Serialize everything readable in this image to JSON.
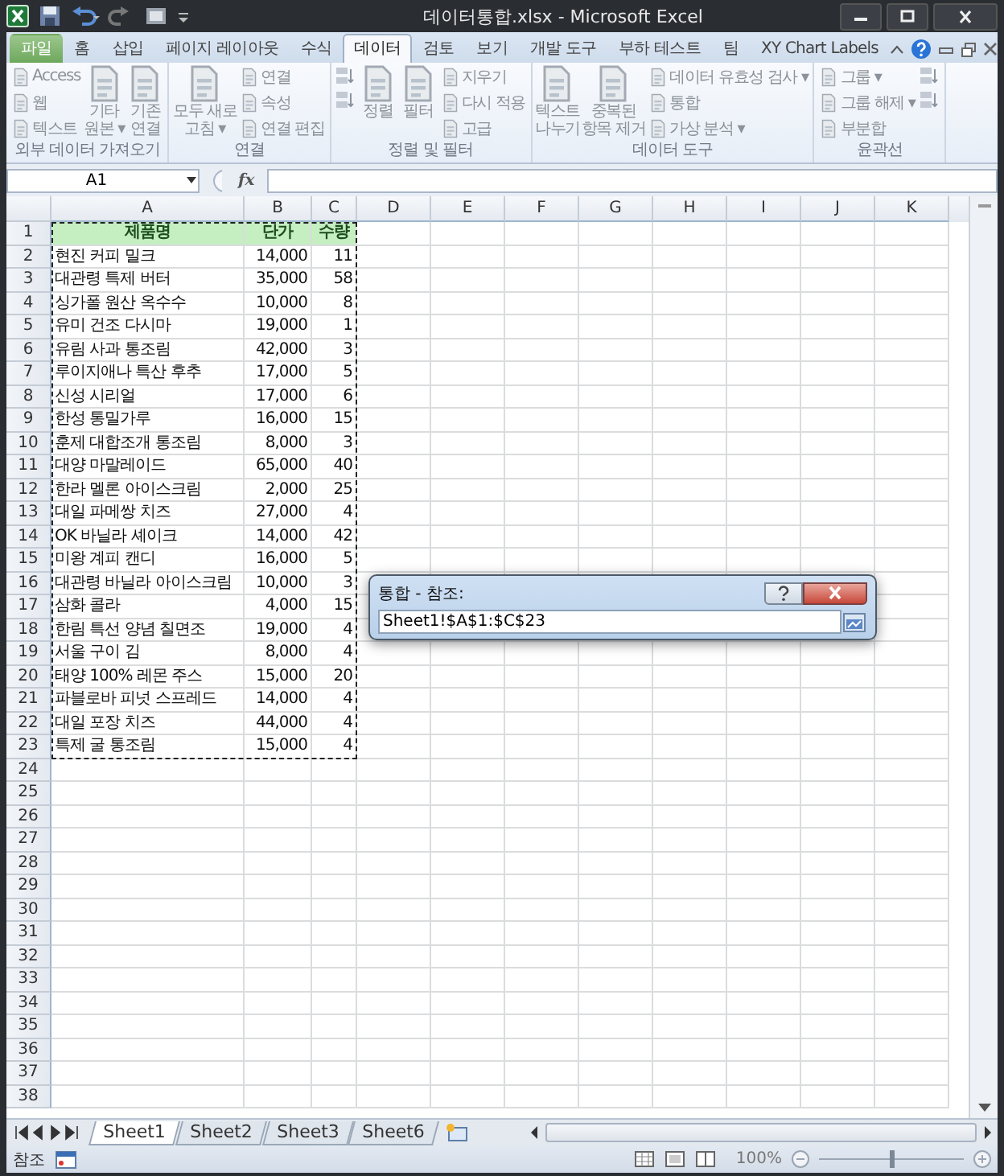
{
  "window": {
    "title": "데이터통합.xlsx - Microsoft Excel"
  },
  "ribbon_tabs": [
    {
      "label": "파일",
      "kind": "file",
      "selected": false
    },
    {
      "label": "홈",
      "kind": "tab",
      "selected": false
    },
    {
      "label": "삽입",
      "kind": "tab",
      "selected": false
    },
    {
      "label": "페이지 레이아웃",
      "kind": "tab",
      "selected": false
    },
    {
      "label": "수식",
      "kind": "tab",
      "selected": false
    },
    {
      "label": "데이터",
      "kind": "tab",
      "selected": true
    },
    {
      "label": "검토",
      "kind": "tab",
      "selected": false
    },
    {
      "label": "보기",
      "kind": "tab",
      "selected": false
    },
    {
      "label": "개발 도구",
      "kind": "tab",
      "selected": false
    },
    {
      "label": "부하 테스트",
      "kind": "tab",
      "selected": false
    },
    {
      "label": "팀",
      "kind": "tab",
      "selected": false
    },
    {
      "label": "XY Chart Labels",
      "kind": "tab",
      "selected": false
    }
  ],
  "ribbon_groups": [
    {
      "label": "외부 데이터 가져오기",
      "items": [
        {
          "kind": "small",
          "lines": [
            "Access"
          ]
        },
        {
          "kind": "small",
          "lines": [
            "웹"
          ]
        },
        {
          "kind": "small",
          "lines": [
            "텍스트"
          ]
        },
        {
          "kind": "large",
          "lines": [
            "기타",
            "원본 ▾"
          ]
        },
        {
          "kind": "large",
          "lines": [
            "기존",
            "연결"
          ]
        }
      ]
    },
    {
      "label": "연결",
      "items": [
        {
          "kind": "large",
          "lines": [
            "모두 새로",
            "고침 ▾"
          ]
        },
        {
          "kind": "small",
          "lines": [
            "연결"
          ]
        },
        {
          "kind": "small",
          "lines": [
            "속성"
          ]
        },
        {
          "kind": "small",
          "lines": [
            "연결 편집"
          ]
        }
      ]
    },
    {
      "label": "정렬 및 필터",
      "items": [
        {
          "kind": "icons"
        },
        {
          "kind": "large",
          "lines": [
            "정렬"
          ]
        },
        {
          "kind": "large",
          "lines": [
            "필터"
          ]
        },
        {
          "kind": "small",
          "lines": [
            "지우기"
          ]
        },
        {
          "kind": "small",
          "lines": [
            "다시 적용"
          ]
        },
        {
          "kind": "small",
          "lines": [
            "고급"
          ]
        }
      ]
    },
    {
      "label": "데이터 도구",
      "items": [
        {
          "kind": "large",
          "lines": [
            "텍스트",
            "나누기"
          ]
        },
        {
          "kind": "large",
          "lines": [
            "중복된",
            "항목 제거"
          ]
        },
        {
          "kind": "small",
          "lines": [
            "데이터 유효성 검사 ▾"
          ]
        },
        {
          "kind": "small",
          "lines": [
            "통합"
          ]
        },
        {
          "kind": "small",
          "lines": [
            "가상 분석 ▾"
          ]
        }
      ]
    },
    {
      "label": "윤곽선",
      "items": [
        {
          "kind": "small",
          "lines": [
            "그룹 ▾"
          ]
        },
        {
          "kind": "small",
          "lines": [
            "그룹 해제 ▾"
          ]
        },
        {
          "kind": "small",
          "lines": [
            "부분합"
          ]
        },
        {
          "kind": "icons"
        }
      ]
    }
  ],
  "formula_bar": {
    "name_box": "A1",
    "function_label": "fx"
  },
  "columns": [
    "A",
    "B",
    "C",
    "D",
    "E",
    "F",
    "G",
    "H",
    "I",
    "J",
    "K"
  ],
  "rows": [
    {
      "number": "1",
      "kind": "header",
      "cells": [
        "제품명",
        "단가",
        "수량"
      ]
    },
    {
      "number": "2",
      "kind": "data",
      "cells": [
        "현진 커피 밀크",
        "14,000",
        "11"
      ]
    },
    {
      "number": "3",
      "kind": "data",
      "cells": [
        "대관령 특제 버터",
        "35,000",
        "58"
      ]
    },
    {
      "number": "4",
      "kind": "data",
      "cells": [
        "싱가폴 원산 옥수수",
        "10,000",
        "8"
      ]
    },
    {
      "number": "5",
      "kind": "data",
      "cells": [
        "유미 건조 다시마",
        "19,000",
        "1"
      ]
    },
    {
      "number": "6",
      "kind": "data",
      "cells": [
        "유림 사과 통조림",
        "42,000",
        "3"
      ]
    },
    {
      "number": "7",
      "kind": "data",
      "cells": [
        "루이지애나 특산 후추",
        "17,000",
        "5"
      ]
    },
    {
      "number": "8",
      "kind": "data",
      "cells": [
        "신성 시리얼",
        "17,000",
        "6"
      ]
    },
    {
      "number": "9",
      "kind": "data",
      "cells": [
        "한성 통밀가루",
        "16,000",
        "15"
      ]
    },
    {
      "number": "10",
      "kind": "data",
      "cells": [
        "훈제 대합조개 통조림",
        "8,000",
        "3"
      ]
    },
    {
      "number": "11",
      "kind": "data",
      "cells": [
        "대양 마말레이드",
        "65,000",
        "40"
      ]
    },
    {
      "number": "12",
      "kind": "data",
      "cells": [
        "한라 멜론 아이스크림",
        "2,000",
        "25"
      ]
    },
    {
      "number": "13",
      "kind": "data",
      "cells": [
        "대일 파메쌍 치즈",
        "27,000",
        "4"
      ]
    },
    {
      "number": "14",
      "kind": "data",
      "cells": [
        "OK 바닐라 셰이크",
        "14,000",
        "42"
      ]
    },
    {
      "number": "15",
      "kind": "data",
      "cells": [
        "미왕 계피 캔디",
        "16,000",
        "5"
      ]
    },
    {
      "number": "16",
      "kind": "data",
      "cells": [
        "대관령 바닐라 아이스크림",
        "10,000",
        "3"
      ]
    },
    {
      "number": "17",
      "kind": "data",
      "cells": [
        "삼화 콜라",
        "4,000",
        "15"
      ]
    },
    {
      "number": "18",
      "kind": "data",
      "cells": [
        "한림 특선 양념 칠면조",
        "19,000",
        "4"
      ]
    },
    {
      "number": "19",
      "kind": "data",
      "cells": [
        "서울 구이 김",
        "8,000",
        "4"
      ]
    },
    {
      "number": "20",
      "kind": "data",
      "cells": [
        "태양 100% 레몬 주스",
        "15,000",
        "20"
      ]
    },
    {
      "number": "21",
      "kind": "data",
      "cells": [
        "파블로바 피넛 스프레드",
        "14,000",
        "4"
      ]
    },
    {
      "number": "22",
      "kind": "data",
      "cells": [
        "대일 포장 치즈",
        "44,000",
        "4"
      ]
    },
    {
      "number": "23",
      "kind": "data",
      "cells": [
        "특제 굴 통조림",
        "15,000",
        "4"
      ]
    },
    {
      "number": "24",
      "kind": "empty"
    },
    {
      "number": "25",
      "kind": "empty"
    },
    {
      "number": "26",
      "kind": "empty"
    },
    {
      "number": "27",
      "kind": "empty"
    },
    {
      "number": "28",
      "kind": "empty"
    },
    {
      "number": "29",
      "kind": "empty"
    },
    {
      "number": "30",
      "kind": "empty"
    },
    {
      "number": "31",
      "kind": "empty"
    },
    {
      "number": "32",
      "kind": "empty"
    },
    {
      "number": "33",
      "kind": "empty"
    },
    {
      "number": "34",
      "kind": "empty"
    },
    {
      "number": "35",
      "kind": "empty"
    },
    {
      "number": "36",
      "kind": "empty"
    },
    {
      "number": "37",
      "kind": "empty"
    },
    {
      "number": "38",
      "kind": "empty"
    }
  ],
  "dialog": {
    "title": "통합 - 참조:",
    "value": "Sheet1!$A$1:$C$23"
  },
  "sheet_tabs": [
    {
      "label": "Sheet1",
      "selected": true
    },
    {
      "label": "Sheet2",
      "selected": false
    },
    {
      "label": "Sheet3",
      "selected": false
    },
    {
      "label": "Sheet6",
      "selected": false
    }
  ],
  "status_bar": {
    "mode": "참조",
    "zoom": "100%",
    "zoom_slider": {
      "level": 0.5
    }
  }
}
